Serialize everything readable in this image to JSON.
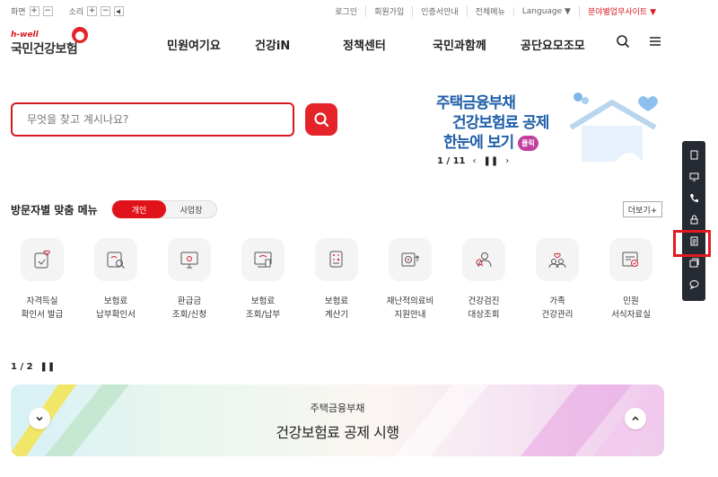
{
  "utility": {
    "screen_label": "화면",
    "sound_label": "소리",
    "links": [
      "로그인",
      "회원가입",
      "인증서안내",
      "전체메뉴",
      "Language ▼"
    ],
    "field_sites": "분야별업무사이트 ▼"
  },
  "logo": {
    "sub": "h-well",
    "main": "국민건강보험"
  },
  "gnb": [
    "민원여기요",
    "건강iN",
    "정책센터",
    "국민과함께",
    "공단요모조모"
  ],
  "search": {
    "placeholder": "무엇을 찾고 계시나요?"
  },
  "banner": {
    "line1": "주택금융부채",
    "line2": "건강보험료 공제",
    "line3": "한눈에 보기",
    "click": "클릭",
    "pager": "1 / 11"
  },
  "persona": {
    "title": "방문자별 맞춤 메뉴",
    "tab_personal": "개인",
    "tab_business": "사업장",
    "more": "더보기+"
  },
  "services": [
    {
      "line1": "자격득실",
      "line2": "확인서 발급"
    },
    {
      "line1": "보험료",
      "line2": "납부확인서"
    },
    {
      "line1": "환급금",
      "line2": "조회/신청"
    },
    {
      "line1": "보험료",
      "line2": "조회/납부"
    },
    {
      "line1": "보험료",
      "line2": "계산기"
    },
    {
      "line1": "재난적의료비",
      "line2": "지원안내"
    },
    {
      "line1": "건강검진",
      "line2": "대상조회"
    },
    {
      "line1": "가족",
      "line2": "건강관리"
    },
    {
      "line1": "민원",
      "line2": "서식자료실"
    }
  ],
  "pager2": "1 / 2",
  "bottom_banner": {
    "line1": "주택금융부채",
    "line2": "건강보험료 공제 시행"
  },
  "colors": {
    "accent": "#d7191f",
    "banner_blue": "#1f5fa8",
    "quick_bg": "#252a33"
  }
}
